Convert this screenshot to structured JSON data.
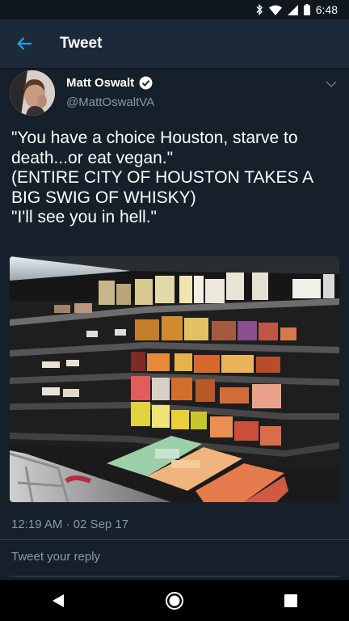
{
  "status_bar": {
    "time": "6:48",
    "icons": [
      "bluetooth-icon",
      "wifi-icon",
      "cell-signal-icon",
      "battery-icon"
    ]
  },
  "app_bar": {
    "title": "Tweet",
    "back_icon": "arrow-left-icon"
  },
  "tweet": {
    "author_name": "Matt Oswalt",
    "verified": true,
    "handle": "@MattOswaltVA",
    "text": "\"You have a choice Houston, starve to death...or eat vegan.\"\n(ENTIRE CITY OF HOUSTON TAKES A BIG SWIG OF WHISKY)\n\"I'll see you in hell.\"",
    "timestamp": "12:19 AM · 02 Sep 17",
    "menu_icon": "chevron-down-icon"
  },
  "reply": {
    "placeholder": "Tweet your reply"
  },
  "nav_bar": {
    "buttons": [
      "back-triangle-icon",
      "home-circle-icon",
      "recents-square-icon"
    ]
  },
  "colors": {
    "background": "#15202b",
    "app_bar": "#1c2938",
    "accent": "#1da1f2",
    "secondary_text": "#8899a6",
    "divider": "#38444d"
  }
}
